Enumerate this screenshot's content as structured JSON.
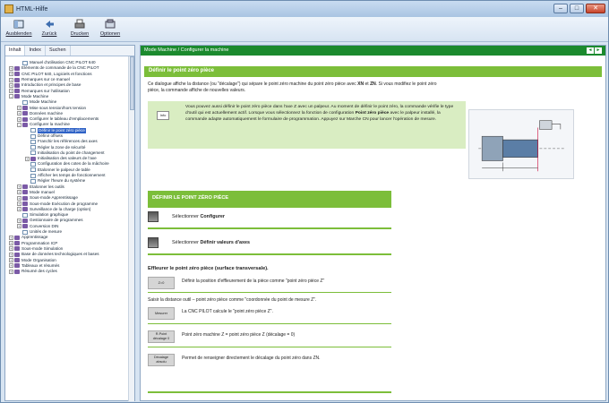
{
  "window": {
    "title": "HTML-Hilfe"
  },
  "toolbar": {
    "items": [
      "Ausblenden",
      "Zurück",
      "Drucken",
      "Optionen"
    ]
  },
  "nav": {
    "tabs": [
      "Inhalt",
      "Index",
      "Suchen"
    ],
    "tree": [
      {
        "t": "Manuel d'utilisation CNC PILOT 640",
        "lvl": 1,
        "ic": "page",
        "tw": ""
      },
      {
        "t": "Eléments de commande de la CNC PILOT",
        "lvl": 0,
        "ic": "book",
        "tw": "+"
      },
      {
        "t": "CNC PILOT 640, Logiciels et fonctions",
        "lvl": 0,
        "ic": "book",
        "tw": "+"
      },
      {
        "t": "Remarques sur ce manuel",
        "lvl": 0,
        "ic": "book",
        "tw": "+"
      },
      {
        "t": "Introduction et principes de base",
        "lvl": 0,
        "ic": "book",
        "tw": "+"
      },
      {
        "t": "Remarques sur l'utilisation",
        "lvl": 0,
        "ic": "book",
        "tw": "+"
      },
      {
        "t": "Mode Machine",
        "lvl": 0,
        "ic": "book",
        "tw": "-"
      },
      {
        "t": "Mode Machine",
        "lvl": 1,
        "ic": "page",
        "tw": ""
      },
      {
        "t": "Mise sous tension/hors tension",
        "lvl": 1,
        "ic": "book",
        "tw": "+"
      },
      {
        "t": "Données machine",
        "lvl": 1,
        "ic": "book",
        "tw": "+"
      },
      {
        "t": "Configurer le tableau d'emplacements",
        "lvl": 1,
        "ic": "book",
        "tw": "+"
      },
      {
        "t": "Configurer la machine",
        "lvl": 1,
        "ic": "book",
        "tw": "-"
      },
      {
        "t": "Définir le point zéro pièce",
        "lvl": 2,
        "ic": "page",
        "tw": "",
        "sel": true
      },
      {
        "t": "Définir offsets",
        "lvl": 2,
        "ic": "page",
        "tw": ""
      },
      {
        "t": "Franchir les références des axes",
        "lvl": 2,
        "ic": "page",
        "tw": ""
      },
      {
        "t": "Régler la zone de sécurité",
        "lvl": 2,
        "ic": "page",
        "tw": ""
      },
      {
        "t": "Initialisation du point de changement",
        "lvl": 2,
        "ic": "page",
        "tw": ""
      },
      {
        "t": "Initialisation des valeurs de l'axe",
        "lvl": 2,
        "ic": "book",
        "tw": "+"
      },
      {
        "t": "Configuration des cotes de la mâchoire",
        "lvl": 2,
        "ic": "page",
        "tw": ""
      },
      {
        "t": "Etalonner le palpeur de table",
        "lvl": 2,
        "ic": "page",
        "tw": ""
      },
      {
        "t": "Afficher les temps de fonctionnement",
        "lvl": 2,
        "ic": "page",
        "tw": ""
      },
      {
        "t": "Régler l'heure du système",
        "lvl": 2,
        "ic": "page",
        "tw": ""
      },
      {
        "t": "Etalonner les outils",
        "lvl": 1,
        "ic": "book",
        "tw": "+"
      },
      {
        "t": "Mode manuel",
        "lvl": 1,
        "ic": "book",
        "tw": "+"
      },
      {
        "t": "Sous-mode Apprentissage",
        "lvl": 1,
        "ic": "book",
        "tw": "+"
      },
      {
        "t": "Sous-mode Exécution de programme",
        "lvl": 1,
        "ic": "book",
        "tw": "+"
      },
      {
        "t": "Surveillance de la charge (option)",
        "lvl": 1,
        "ic": "book",
        "tw": "+"
      },
      {
        "t": "Simulation graphique",
        "lvl": 1,
        "ic": "page",
        "tw": ""
      },
      {
        "t": "Gestionnaire de programmes",
        "lvl": 1,
        "ic": "book",
        "tw": "+"
      },
      {
        "t": "Conversion DIN",
        "lvl": 1,
        "ic": "book",
        "tw": "+"
      },
      {
        "t": "Unités de mesure",
        "lvl": 1,
        "ic": "page",
        "tw": ""
      },
      {
        "t": "Apprentissage",
        "lvl": 0,
        "ic": "book",
        "tw": "+"
      },
      {
        "t": "Programmation ICP",
        "lvl": 0,
        "ic": "book",
        "tw": "+"
      },
      {
        "t": "Sous-mode Simulation",
        "lvl": 0,
        "ic": "book",
        "tw": "+"
      },
      {
        "t": "Base de données technologiques et bases",
        "lvl": 0,
        "ic": "book",
        "tw": "+"
      },
      {
        "t": "Mode Organisation",
        "lvl": 0,
        "ic": "book",
        "tw": "+"
      },
      {
        "t": "Tableaux et résumés",
        "lvl": 0,
        "ic": "book",
        "tw": "+"
      },
      {
        "t": "Résumé des cycles",
        "lvl": 0,
        "ic": "book",
        "tw": "+"
      }
    ]
  },
  "content": {
    "breadcrumb": "Mode Machine / Configurer la machine",
    "banner": "Définir le point zéro pièce",
    "intro_pre": "Ce dialogue affiche la distance (ou \"décalage\") qui sépare le point zéro machine du point zéro pièce avec ",
    "intro_b1": "XN",
    "intro_mid": " et ",
    "intro_b2": "ZN",
    "intro_post": ". Si vous modifiez le point zéro pièce, la commande affiche de nouvelles valeurs.",
    "note_tag": "Info",
    "note_pre": "Vous pouvez aussi définir le point zéro pièce dans l'axe Z avec un palpeur. Au moment de définir le point zéro, la commande vérifie le type d'outil qui est actuellement actif. Lorsque vous sélectionnez la fonction de configuration ",
    "note_b": "Point zéro pièce",
    "note_post": " avec le palpeur installé, la commande adapte automatiquement le formulaire de programmation. Appuyez sur Marche CN pour lancer l'opération de mesure.",
    "section_title": "DÉFINIR LE POINT ZÉRO PIÈCE",
    "step1_pre": "Sélectionner ",
    "step1_b": "Configurer",
    "step2_pre": "Sélectionner ",
    "step2_b": "Définir valeurs d'axes",
    "heading2": "Effleurer le point zéro pièce (surface transversale).",
    "row1_btn": "Z=0",
    "row1_txt": "Définir la position d'effleurement de la pièce comme \"point zéro pièce Z\"",
    "plain_line": "Saisir la distance outil – point zéro pièce comme \"coordonnée du point de mesure Z\".",
    "row2_btn": "Mesurer",
    "row2_txt": "La CNC PILOT calcule le \"point zéro pièce Z\".",
    "row3_btn": "R.Point décalage 0",
    "row3_txt": "Point zéro machine Z = point zéro pièce Z (décalage = 0)",
    "row4_btn": "Décalage absolu",
    "row4_txt": "Permet de renseigner directement le décalage du point zéro dans ZN."
  }
}
